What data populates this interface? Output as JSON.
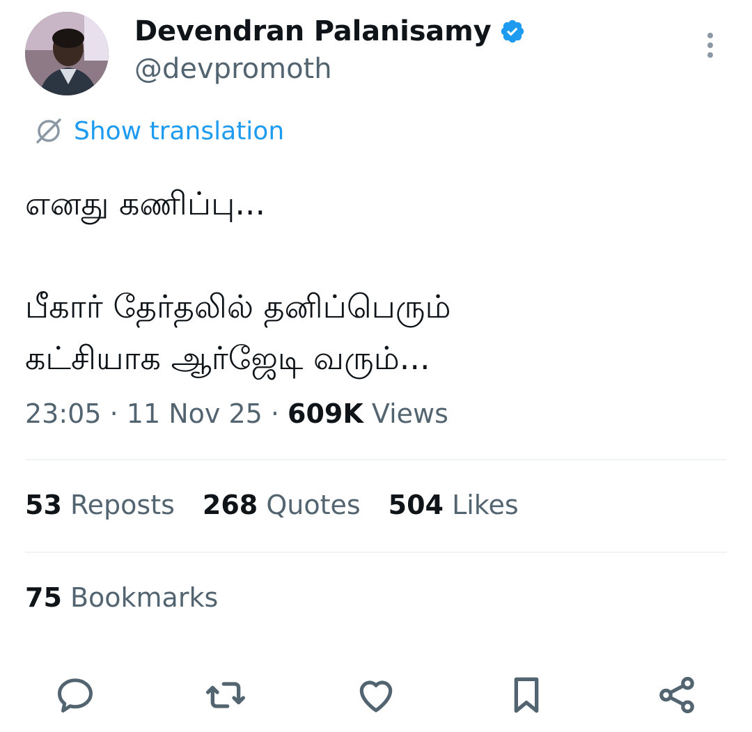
{
  "author": {
    "name": "Devendran Palanisamy",
    "handle": "@devpromoth",
    "verified": true
  },
  "translation": {
    "label": "Show translation"
  },
  "tweet": {
    "text": "எனது கணிப்பு...\n\nபீகார் தேர்தலில் தனிப்பெரும்\nகட்சியாக ஆர்ஜேடி வரும்..."
  },
  "meta": {
    "time": "23:05",
    "sep1": " · ",
    "date": "11 Nov 25",
    "sep2": " · ",
    "views_count": "609K",
    "views_label": " Views"
  },
  "stats": {
    "reposts_count": "53",
    "reposts_label": " Reposts",
    "quotes_count": "268",
    "quotes_label": " Quotes",
    "likes_count": "504",
    "likes_label": " Likes",
    "bookmarks_count": "75",
    "bookmarks_label": " Bookmarks"
  },
  "actions": [
    "reply-icon",
    "repost-icon",
    "like-icon",
    "bookmark-icon",
    "share-icon"
  ],
  "colors": {
    "accent": "#1d9bf0",
    "text_primary": "#0f1419",
    "text_secondary": "#536471",
    "divider": "#eff3f4"
  }
}
